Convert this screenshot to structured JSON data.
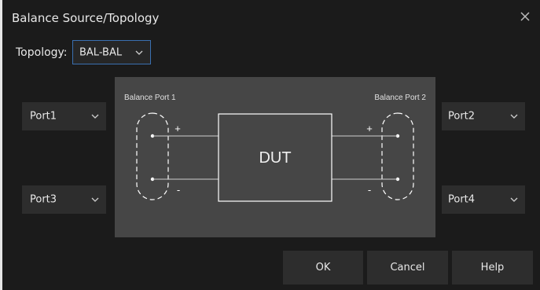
{
  "dialog": {
    "title": "Balance Source/Topology",
    "close_icon": "close-icon"
  },
  "topology": {
    "label": "Topology:",
    "value": "BAL-BAL"
  },
  "ports": {
    "port1": "Port1",
    "port2": "Port2",
    "port3": "Port3",
    "port4": "Port4"
  },
  "diagram": {
    "left_label": "Balance Port 1",
    "right_label": "Balance Port 2",
    "dut_label": "DUT",
    "plus": "+",
    "minus": "-"
  },
  "buttons": {
    "ok": "OK",
    "cancel": "Cancel",
    "help": "Help"
  },
  "colors": {
    "background": "#1b1b1b",
    "control": "#2d2d2d",
    "diagram": "#464646",
    "accent": "#3a6fb0",
    "text": "#e8e8e8"
  }
}
